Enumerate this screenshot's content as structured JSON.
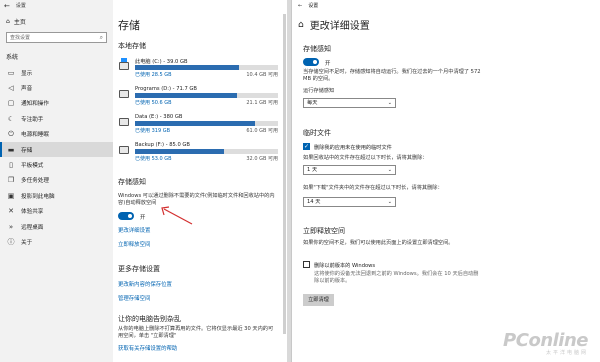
{
  "left": {
    "window_title": "设置",
    "nav": {
      "home": "主页",
      "search_placeholder": "查找设置",
      "section": "系统",
      "items": [
        {
          "label": "显示",
          "icon": "monitor-icon"
        },
        {
          "label": "声音",
          "icon": "speaker-icon"
        },
        {
          "label": "通知和操作",
          "icon": "notification-icon"
        },
        {
          "label": "专注助手",
          "icon": "moon-icon"
        },
        {
          "label": "电源和睡眠",
          "icon": "power-icon"
        },
        {
          "label": "存储",
          "icon": "storage-icon"
        },
        {
          "label": "平板模式",
          "icon": "tablet-icon"
        },
        {
          "label": "多任务处理",
          "icon": "multitask-icon"
        },
        {
          "label": "投影到此电脑",
          "icon": "project-icon"
        },
        {
          "label": "体验共享",
          "icon": "share-icon"
        },
        {
          "label": "远程桌面",
          "icon": "remote-icon"
        },
        {
          "label": "关于",
          "icon": "info-icon"
        }
      ]
    },
    "page_title": "存储",
    "local_storage_title": "本地存储",
    "drives": [
      {
        "name": "此电脑 (C:) - 39.0 GB",
        "used": "已使用 28.5 GB",
        "free": "10.4 GB 可用",
        "fill": 0.73,
        "system": true
      },
      {
        "name": "Programs (D:) - 71.7 GB",
        "used": "已使用 50.6 GB",
        "free": "21.1 GB 可用",
        "fill": 0.71,
        "system": false
      },
      {
        "name": "Data (E:) - 380 GB",
        "used": "已使用 319 GB",
        "free": "61.0 GB 可用",
        "fill": 0.84,
        "system": false
      },
      {
        "name": "Backup (F:) - 85.0 GB",
        "used": "已使用 53.0 GB",
        "free": "32.0 GB 可用",
        "fill": 0.62,
        "system": false
      }
    ],
    "sense_title": "存储感知",
    "sense_desc": "Windows 可以通过删除不需要的文件(例如临时文件和回收站中的内容)自动释放空间",
    "toggle_label": "开",
    "link_change": "更改详细设置",
    "link_free_now": "立即释放空间",
    "more_title": "更多存储设置",
    "link_save_location": "更改新内容的保存位置",
    "link_spaces": "管理存储空间",
    "tell_title": "让你的电脑告别杂乱",
    "tell_desc": "从你的电脑上删除不打算再用的文件。它将仅显示最近 30 天内的可用空间，单击 \"立即清理\"",
    "link_help": "获取有关存储设置的帮助"
  },
  "right": {
    "window_title": "设置",
    "page_title": "更改详细设置",
    "sense_title": "存储感知",
    "toggle_label": "开",
    "sense_desc": "当存储空间不足时，存储感知将自动运行。我们在过去的一个月中清理了 572 MB 的空间。",
    "run_label": "运行存储感知",
    "run_value": "每天",
    "temp_title": "临时文件",
    "temp_check_label": "删除我的应用未在使用的临时文件",
    "recycle_label": "如果回收站中的文件存在超过以下时长，请将其删除：",
    "recycle_value": "1 天",
    "downloads_label": "如果\"下载\"文件夹中的文件存在超过以下时长，请将其删除：",
    "downloads_value": "14 天",
    "free_title": "立即释放空间",
    "free_desc": "如果你的空间不足，我们可以使用此页面上的设置立即清理空间。",
    "old_windows_label": "删除以前版本的 Windows",
    "old_windows_desc": "这将使你的设备无法回退到之前的 Windows。我们会在 10 天后自动删除以前的版本。",
    "clean_button": "立即清理"
  },
  "watermark": {
    "brand": "PConline",
    "tagline": "太平洋电脑网"
  },
  "colors": {
    "accent": "#0063b1",
    "bar_fill": "#2b6cb0"
  }
}
